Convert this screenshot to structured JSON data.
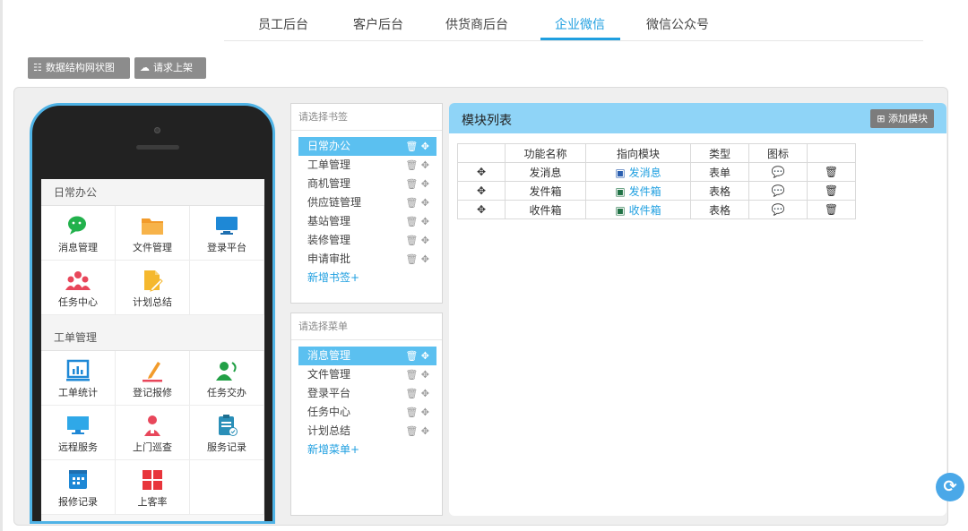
{
  "nav": {
    "tabs": [
      "员工后台",
      "客户后台",
      "供货商后台",
      "企业微信",
      "微信公众号"
    ],
    "active_index": 3
  },
  "toolbar": {
    "structure_label": "数据结构网状图",
    "publish_label": "请求上架"
  },
  "phone": {
    "sections": [
      {
        "title": "日常办公",
        "items": [
          {
            "label": "消息管理",
            "icon": "wechat-chat-icon"
          },
          {
            "label": "文件管理",
            "icon": "folder-icon"
          },
          {
            "label": "登录平台",
            "icon": "monitor-icon"
          },
          {
            "label": "任务中心",
            "icon": "people-group-icon"
          },
          {
            "label": "计划总结",
            "icon": "document-pen-icon"
          }
        ]
      },
      {
        "title": "工单管理",
        "items": [
          {
            "label": "工单统计",
            "icon": "bar-chart-icon"
          },
          {
            "label": "登记报修",
            "icon": "pen-line-icon"
          },
          {
            "label": "任务交办",
            "icon": "user-transfer-icon"
          },
          {
            "label": "远程服务",
            "icon": "desktop-icon"
          },
          {
            "label": "上门巡查",
            "icon": "inspector-icon"
          },
          {
            "label": "服务记录",
            "icon": "clipboard-check-icon"
          },
          {
            "label": "报修记录",
            "icon": "calendar-grid-icon"
          },
          {
            "label": "上客率",
            "icon": "tiles-icon"
          }
        ]
      }
    ]
  },
  "tags": {
    "placeholder": "请选择书签",
    "items": [
      "日常办公",
      "工单管理",
      "商机管理",
      "供应链管理",
      "基站管理",
      "装修管理",
      "申请审批"
    ],
    "selected_index": 0,
    "add_label": "新增书签+"
  },
  "menus": {
    "placeholder": "请选择菜单",
    "items": [
      "消息管理",
      "文件管理",
      "登录平台",
      "任务中心",
      "计划总结"
    ],
    "selected_index": 0,
    "add_label": "新增菜单+"
  },
  "modules": {
    "title": "模块列表",
    "add_label": "添加模块",
    "columns": [
      "",
      "功能名称",
      "指向模块",
      "类型",
      "图标",
      ""
    ],
    "rows": [
      {
        "name": "发消息",
        "target": "发消息",
        "target_icon": "word-doc-icon",
        "type": "表单",
        "icon": "chat-icon"
      },
      {
        "name": "发件箱",
        "target": "发件箱",
        "target_icon": "excel-sheet-icon",
        "type": "表格",
        "icon": "chat-icon"
      },
      {
        "name": "收件箱",
        "target": "收件箱",
        "target_icon": "excel-sheet-icon",
        "type": "表格",
        "icon": "chat-icon"
      }
    ]
  },
  "colors": {
    "accent": "#1f9fe0",
    "selected_bg": "#5bc0f0",
    "module_header": "#8fd4f7",
    "phone_frame": "#4fb3e6"
  }
}
